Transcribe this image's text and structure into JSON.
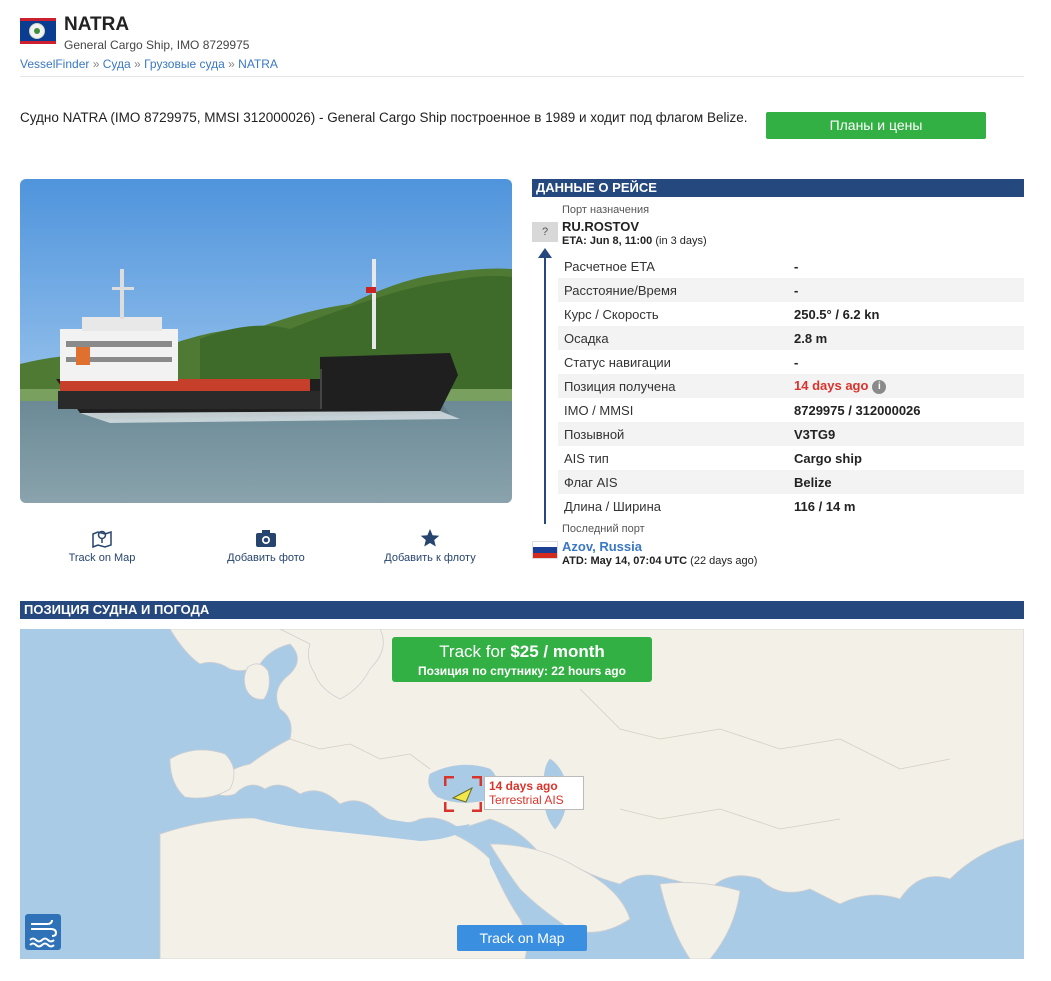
{
  "header": {
    "name": "NATRA",
    "subtitle": "General Cargo Ship, IMO 8729975",
    "breadcrumb": [
      "VesselFinder",
      "Суда",
      "Грузовые суда",
      "NATRA"
    ],
    "breadcrumb_sep": "»"
  },
  "intro": {
    "text": "Судно NATRA (IMO 8729975, MMSI 312000026) - General Cargo Ship построенное в 1989 и ходит под флагом Belize.",
    "plans_button": "Планы и цены"
  },
  "actions": {
    "track_on_map": "Track on Map",
    "add_photo": "Добавить фото",
    "add_to_fleet": "Добавить к флоту"
  },
  "voyage": {
    "title": "ДАННЫЕ О РЕЙСЕ",
    "destination_label": "Порт назначения",
    "destination_unknown_flag": "?",
    "destination": "RU.ROSTOV",
    "eta": "ETA: Jun 8, 11:00",
    "eta_rel": "(in 3 days)",
    "rows": [
      {
        "label": "Расчетное ETA",
        "value": "-"
      },
      {
        "label": "Расстояние/Время",
        "value": "-"
      },
      {
        "label": "Курс / Скорость",
        "value": "250.5° / 6.2 kn"
      },
      {
        "label": "Осадка",
        "value": "2.8 m"
      },
      {
        "label": "Статус навигации",
        "value": "-"
      },
      {
        "label": "Позиция получена",
        "value": "14 days ago"
      },
      {
        "label": "IMO / MMSI",
        "value": "8729975 / 312000026"
      },
      {
        "label": "Позывной",
        "value": "V3TG9"
      },
      {
        "label": "AIS тип",
        "value": "Cargo ship"
      },
      {
        "label": "Флаг AIS",
        "value": "Belize"
      },
      {
        "label": "Длина / Ширина",
        "value": "116 / 14 m"
      }
    ],
    "info_glyph": "i",
    "last_port_label": "Последний порт",
    "last_port": "Azov, Russia",
    "atd": "ATD: May 14, 07:04 UTC",
    "atd_rel": "(22 days ago)"
  },
  "map": {
    "title": "ПОЗИЦИЯ СУДНА И ПОГОДА",
    "track_price_prefix": "Track for",
    "track_price": "$25 / month",
    "satellite_position": "Позиция по спутнику: 22 hours ago",
    "marker_age": "14 days ago",
    "marker_source": "Terrestrial AIS",
    "track_on_map_button": "Track on Map"
  },
  "colors": {
    "accent_green": "#33b044",
    "section_blue": "#25497f",
    "link_blue": "#3a78c3",
    "alert_red": "#d9342b"
  }
}
